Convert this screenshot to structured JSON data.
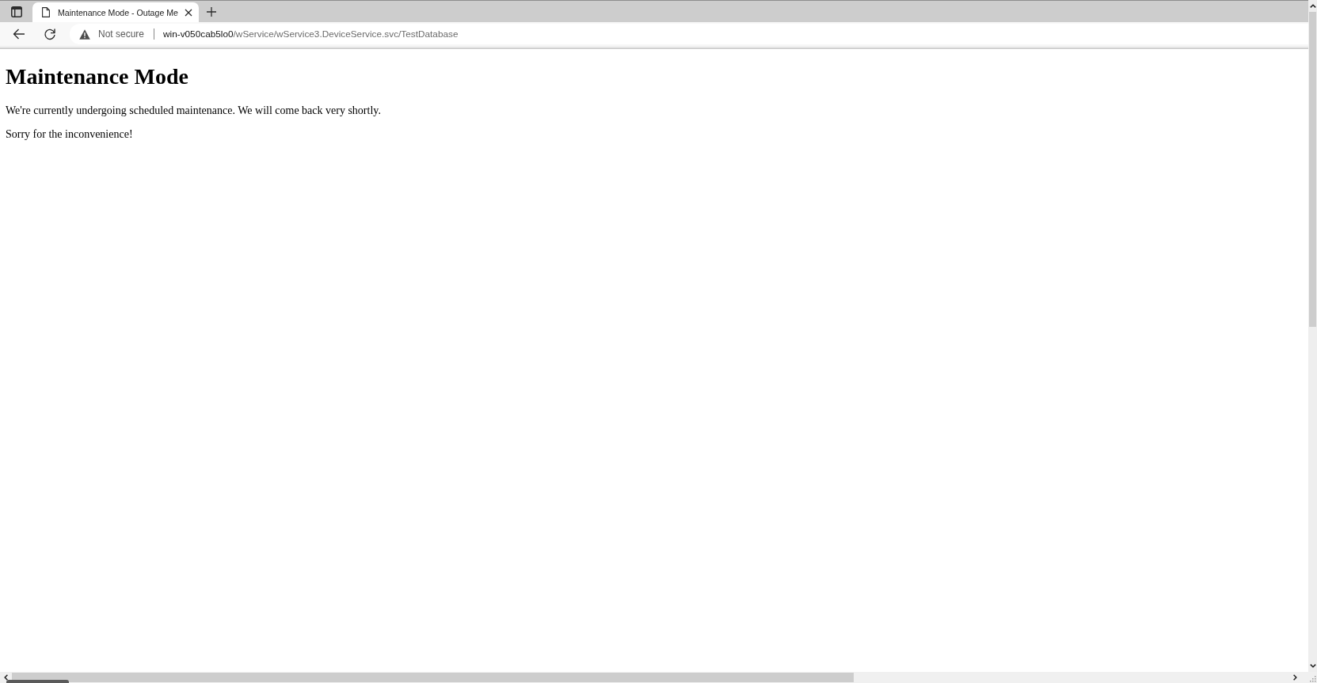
{
  "browser": {
    "tabs": [
      {
        "title": "Maintenance Mode - Outage Me",
        "selected": true
      }
    ],
    "address_bar": {
      "security_label": "Not secure",
      "url_host": "win-v050cab5lo0",
      "url_path": "/wService/wService3.DeviceService.svc/TestDatabase"
    }
  },
  "page": {
    "heading": "Maintenance Mode",
    "paragraphs": [
      "We're currently undergoing scheduled maintenance. We will come back very shortly.",
      "Sorry for the inconvenience!"
    ]
  }
}
